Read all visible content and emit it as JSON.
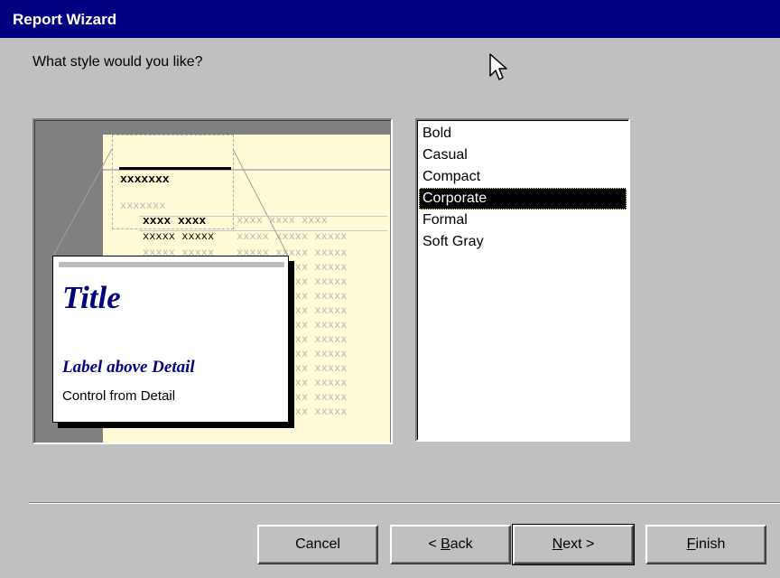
{
  "window": {
    "title": "Report Wizard"
  },
  "prompt": "What style would you like?",
  "preview": {
    "placeholder_bold": "xxxxxxx",
    "placeholder_small": "xxxxxxx",
    "placeholder_header": "xxxx xxxx",
    "placeholder_header_gray": "xxxx xxxx xxxx",
    "placeholder_row": "xxxxx xxxxx",
    "placeholder_row_gray": "xxxxx xxxxx xxxxx",
    "zoom_title": "Title",
    "zoom_label": "Label above Detail",
    "zoom_control": "Control from Detail",
    "colors": {
      "title": "#000080",
      "page_bg": "#fffbd6"
    }
  },
  "styles": {
    "items": [
      "Bold",
      "Casual",
      "Compact",
      "Corporate",
      "Formal",
      "Soft Gray"
    ],
    "selected": "Corporate"
  },
  "buttons": {
    "cancel": "Cancel",
    "back_prefix": "< ",
    "back_mnemonic": "B",
    "back_rest": "ack",
    "next_mnemonic": "N",
    "next_rest": "ext >",
    "finish_mnemonic": "F",
    "finish_rest": "inish"
  },
  "icons": {
    "cursor": "arrow-cursor-icon"
  }
}
